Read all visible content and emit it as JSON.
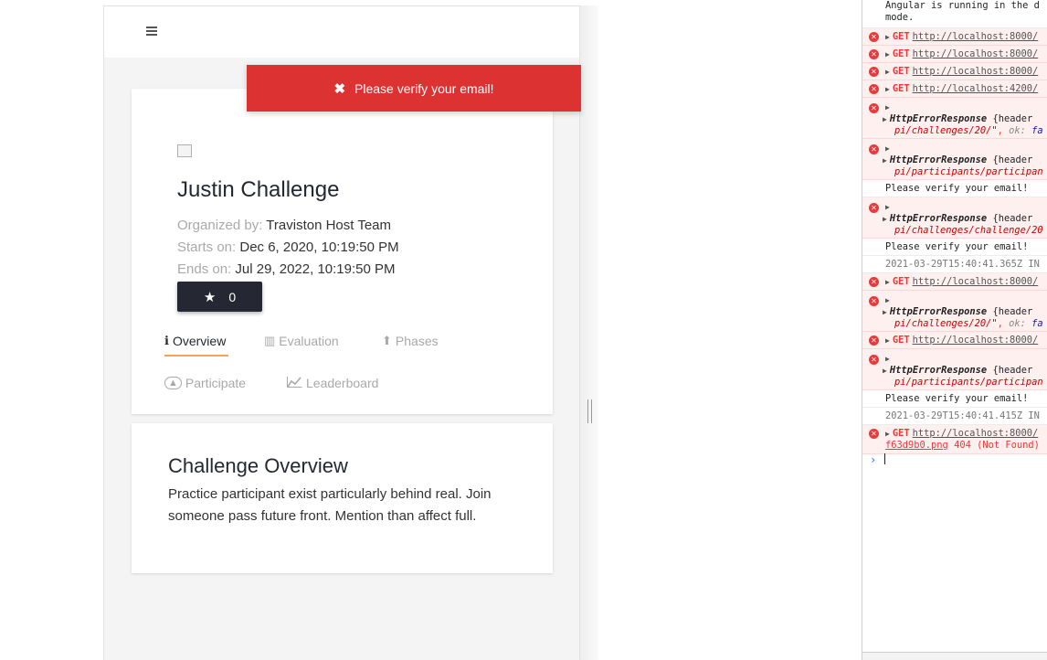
{
  "app": {
    "menu_icon": "hamburger-icon",
    "toast": {
      "icon": "close-icon",
      "message": "Please verify your email!",
      "color": "#dc3232"
    },
    "challenge": {
      "title": "Justin Challenge",
      "organized_label": "Organized by:",
      "organized_value": "Traviston Host Team",
      "starts_label": "Starts on:",
      "starts_value": "Dec 6, 2020, 10:19:50 PM",
      "ends_label": "Ends on:",
      "ends_value": "Jul 29, 2022, 10:19:50 PM",
      "star_icon": "star-icon",
      "star_count": "0"
    },
    "tabs": [
      {
        "label": "Overview",
        "icon": "info-icon",
        "glyph": "ℹ",
        "active": true
      },
      {
        "label": "Evaluation",
        "icon": "bar-chart-icon",
        "glyph": "▥"
      },
      {
        "label": "Phases",
        "icon": "level-up-icon",
        "glyph": "⬆"
      },
      {
        "label": "Participate",
        "icon": "fire-icon",
        "glyph": "⟨🔥⟩"
      },
      {
        "label": "Leaderboard",
        "icon": "line-chart-icon",
        "glyph": "⟋"
      }
    ],
    "overview": {
      "title": "Challenge Overview",
      "text": "Practice participant exist particularly behind real. Join someone pass future front. Mention than affect full."
    },
    "accent_color": "#ffa153",
    "dark_color": "#252833"
  },
  "console": {
    "top_text_1": "Angular is running in the d",
    "top_text_2": "mode.",
    "rows": [
      {
        "method": "GET",
        "url": "http://localhost:8000/"
      },
      {
        "method": "GET",
        "url": "http://localhost:8000/"
      },
      {
        "method": "GET",
        "url": "http://localhost:8000/"
      },
      {
        "method": "GET",
        "url": "http://localhost:4200/"
      }
    ],
    "http_error_1": {
      "name": "HttpErrorResponse",
      "rest": "{header",
      "path": "pi/challenges/20/\"",
      "ok_key": "ok:",
      "ok_val": "fa"
    },
    "http_error_2": {
      "name": "HttpErrorResponse",
      "rest": "{header",
      "path": "pi/participants/participan"
    },
    "verify_1": "Please verify your email!",
    "http_error_3": {
      "name": "HttpErrorResponse",
      "rest": "{header",
      "path": "pi/challenges/challenge/20"
    },
    "verify_2": "Please verify your email!",
    "timestamp_1": "2021-03-29T15:40:41.365Z IN",
    "get_5": {
      "method": "GET",
      "url": "http://localhost:8000/"
    },
    "http_error_4": {
      "name": "HttpErrorResponse",
      "rest": "{header",
      "path": "pi/challenges/20/\"",
      "ok_key": "ok:",
      "ok_val": "fa"
    },
    "get_6": {
      "method": "GET",
      "url": "http://localhost:8000/"
    },
    "http_error_5": {
      "name": "HttpErrorResponse",
      "rest": "{header",
      "path": "pi/participants/participan"
    },
    "verify_3": "Please verify your email!",
    "timestamp_2": "2021-03-29T15:40:41.415Z IN",
    "get_7": {
      "method": "GET",
      "url": "http://localhost:8000/",
      "file": "f63d9b0.png",
      "status": "404 (Not Found)"
    },
    "prompt": "›"
  }
}
